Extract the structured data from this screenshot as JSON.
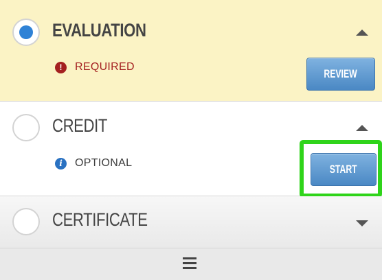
{
  "steps": {
    "evaluation": {
      "title": "EVALUATION",
      "status": "REQUIRED",
      "status_icon": "exclamation-circle-icon",
      "action": "REVIEW",
      "selected": true,
      "expanded": true
    },
    "credit": {
      "title": "CREDIT",
      "status": "OPTIONAL",
      "status_icon": "info-circle-icon",
      "action": "START",
      "selected": false,
      "expanded": true
    },
    "certificate": {
      "title": "CERTIFICATE",
      "selected": false,
      "expanded": false
    }
  },
  "icons": {
    "required": "!",
    "optional": "i",
    "menu": "hamburger-menu-icon"
  },
  "colors": {
    "active_row_bg": "#fbf3c5",
    "required_text": "#a42020",
    "radio_selected": "#2f82d6",
    "button_blue": "#4a88c4",
    "highlight_green": "#2fd41a"
  }
}
